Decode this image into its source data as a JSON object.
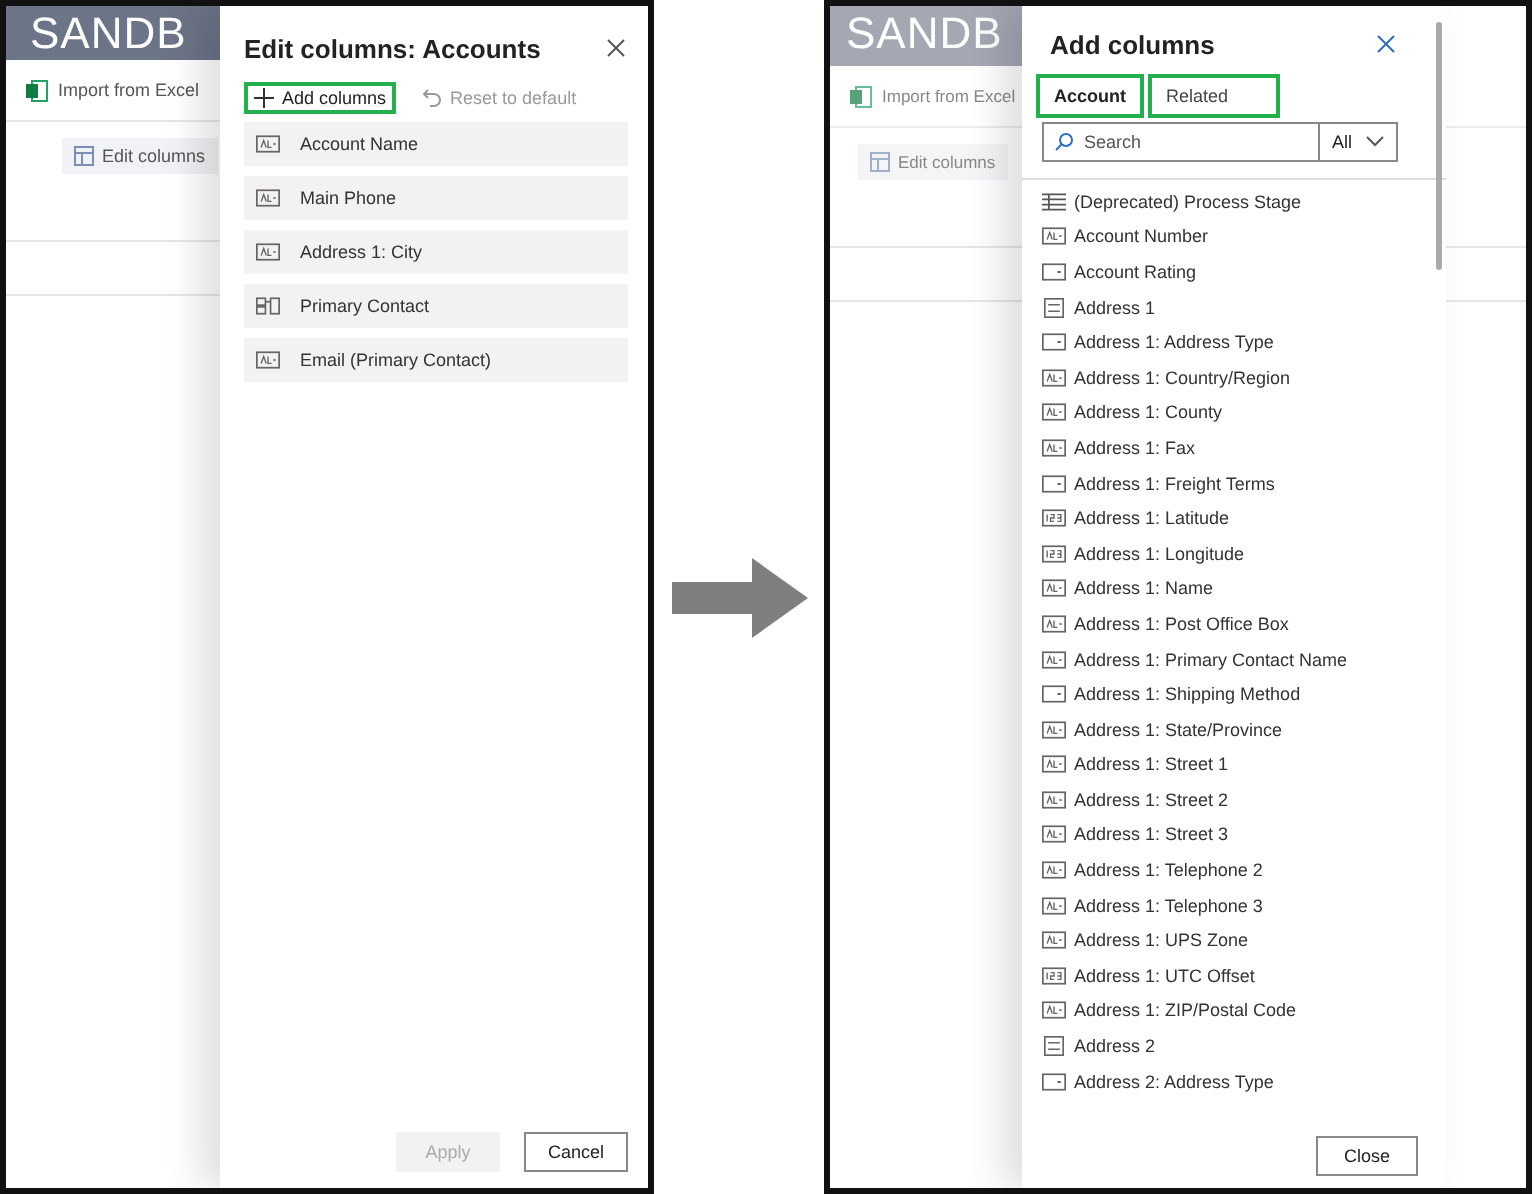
{
  "left_screen": {
    "app": {
      "header": "SANDB",
      "command": "Import from Excel",
      "edit_button": "Edit columns"
    },
    "panel": {
      "title": "Edit columns: Accounts",
      "add_button": {
        "label": "Add columns",
        "highlighted": true
      },
      "reset_button": {
        "label": "Reset to default",
        "disabled": true
      },
      "columns": [
        {
          "name": "Account Name",
          "kind": "text"
        },
        {
          "name": "Main Phone",
          "kind": "text"
        },
        {
          "name": "Address 1: City",
          "kind": "text"
        },
        {
          "name": "Primary Contact",
          "kind": "lookup"
        },
        {
          "name": "Email (Primary Contact)",
          "kind": "text"
        }
      ],
      "apply_button": {
        "label": "Apply",
        "disabled": true
      },
      "cancel_button": {
        "label": "Cancel",
        "disabled": false
      }
    }
  },
  "right_screen": {
    "app": {
      "header": "SANDB",
      "command": "Import from Excel",
      "edit_button": "Edit columns"
    },
    "panel": {
      "title": "Add columns",
      "tabs": [
        {
          "label": "Account",
          "selected": true,
          "highlighted": true
        },
        {
          "label": "Related",
          "selected": false,
          "highlighted": true
        }
      ],
      "search": {
        "placeholder": "Search"
      },
      "filter": {
        "value": "All"
      },
      "columns": [
        {
          "name": "(Deprecated) Process Stage",
          "kind": "grid"
        },
        {
          "name": "Account Number",
          "kind": "text"
        },
        {
          "name": "Account Rating",
          "kind": "option"
        },
        {
          "name": "Address 1",
          "kind": "multiline"
        },
        {
          "name": "Address 1: Address Type",
          "kind": "option"
        },
        {
          "name": "Address 1: Country/Region",
          "kind": "text"
        },
        {
          "name": "Address 1: County",
          "kind": "text"
        },
        {
          "name": "Address 1: Fax",
          "kind": "text"
        },
        {
          "name": "Address 1: Freight Terms",
          "kind": "option"
        },
        {
          "name": "Address 1: Latitude",
          "kind": "number"
        },
        {
          "name": "Address 1: Longitude",
          "kind": "number"
        },
        {
          "name": "Address 1: Name",
          "kind": "text"
        },
        {
          "name": "Address 1: Post Office Box",
          "kind": "text"
        },
        {
          "name": "Address 1: Primary Contact Name",
          "kind": "text"
        },
        {
          "name": "Address 1: Shipping Method",
          "kind": "option"
        },
        {
          "name": "Address 1: State/Province",
          "kind": "text"
        },
        {
          "name": "Address 1: Street 1",
          "kind": "text"
        },
        {
          "name": "Address 1: Street 2",
          "kind": "text"
        },
        {
          "name": "Address 1: Street 3",
          "kind": "text"
        },
        {
          "name": "Address 1: Telephone 2",
          "kind": "text"
        },
        {
          "name": "Address 1: Telephone 3",
          "kind": "text"
        },
        {
          "name": "Address 1: UPS Zone",
          "kind": "text"
        },
        {
          "name": "Address 1: UTC Offset",
          "kind": "number"
        },
        {
          "name": "Address 1: ZIP/Postal Code",
          "kind": "text"
        },
        {
          "name": "Address 2",
          "kind": "multiline"
        },
        {
          "name": "Address 2: Address Type",
          "kind": "option"
        }
      ],
      "close_button": {
        "label": "Close"
      }
    }
  }
}
